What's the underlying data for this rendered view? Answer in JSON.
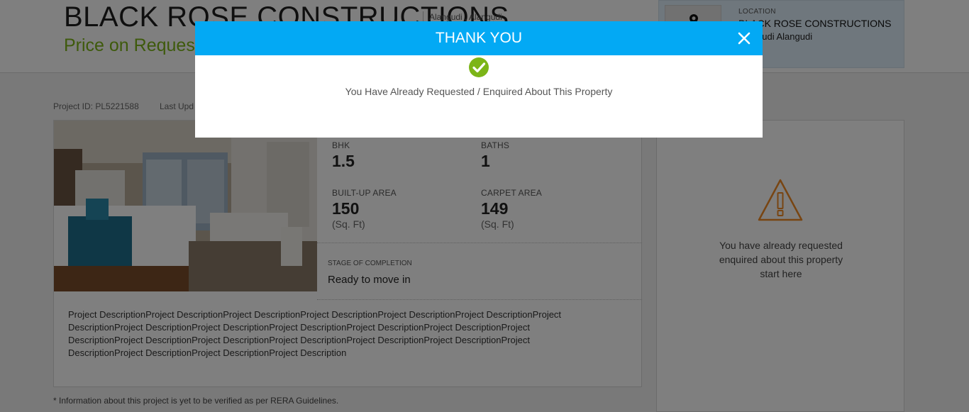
{
  "header": {
    "title": "BLACK ROSE CONSTRUCTIONS",
    "sub_location": "Alangudi , Alangudi",
    "price": "Price on Request"
  },
  "location_card": {
    "label": "LOCATION",
    "name": "BLACK ROSE CONSTRUCTIONS",
    "place": "Alangudi Alangudi",
    "icon": "map-pin-icon"
  },
  "meta": {
    "project_id": "Project ID: PL5221588",
    "last_updated": "Last Upd"
  },
  "stats": {
    "bhk_label": "BHK",
    "bhk_value": "1.5",
    "baths_label": "BATHS",
    "baths_value": "1",
    "builtup_label": "BUILT-UP AREA",
    "builtup_value": "150",
    "builtup_unit": "(Sq. Ft)",
    "carpet_label": "CARPET AREA",
    "carpet_value": "149",
    "carpet_unit": "(Sq. Ft)"
  },
  "stage": {
    "label": "STAGE OF COMPLETION",
    "value": "Ready to move in"
  },
  "description": "Project DescriptionProject DescriptionProject DescriptionProject DescriptionProject DescriptionProject DescriptionProject DescriptionProject DescriptionProject DescriptionProject DescriptionProject DescriptionProject DescriptionProject DescriptionProject DescriptionProject DescriptionProject DescriptionProject DescriptionProject DescriptionProject DescriptionProject DescriptionProject DescriptionProject Description",
  "rera_note": "* Information about this project is yet to be verified as per RERA Guidelines.",
  "side_panel": {
    "icon": "warning-icon",
    "line1": "You have already requested",
    "line2": "enquired about this property",
    "line3": "start here"
  },
  "modal": {
    "title": "THANK YOU",
    "message": "You Have Already Requested / Enquired About This Property",
    "check_icon": "check-circle-icon",
    "close_icon": "close-icon"
  },
  "colors": {
    "modal_header": "#03a9f4",
    "price": "#7cb518",
    "check": "#7cb518",
    "warning": "#f08a24",
    "overlay": "rgba(0,0,0,0.5)"
  }
}
